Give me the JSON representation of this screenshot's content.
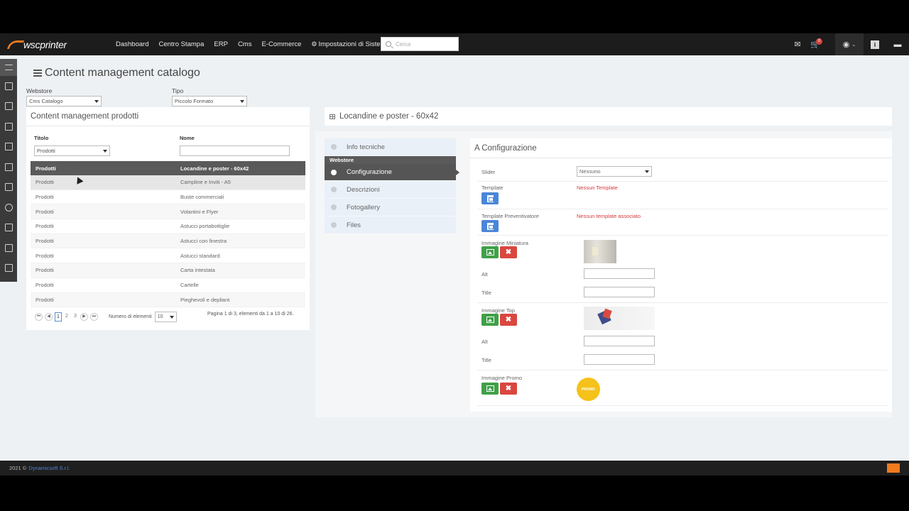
{
  "topbar": {
    "logo_text": "wscprinter",
    "menu": [
      "Dashboard",
      "Centro Stampa",
      "ERP",
      "Cms",
      "E-Commerce",
      "Impostazioni di Sistema"
    ],
    "search_placeholder": "Cerca",
    "cart_badge": "0"
  },
  "page": {
    "title": "Content management catalogo",
    "webstore_label": "Webstore",
    "webstore_value": "Cms Catalogo",
    "tipo_label": "Tipo",
    "tipo_value": "Piccolo Formato"
  },
  "left_panel": {
    "title": "Content management prodotti",
    "col_titolo": "Titolo",
    "col_nome": "Nome",
    "titolo_filter_value": "Prodotti",
    "table_header": [
      "Prodotti",
      "Locandine e poster - 60x42"
    ],
    "rows": [
      [
        "Prodotti",
        "Campline e Inviti - A5"
      ],
      [
        "Prodotti",
        "Buste commerciali"
      ],
      [
        "Prodotti",
        "Volantini e Flyer"
      ],
      [
        "Prodotti",
        "Astucci portabottiglie"
      ],
      [
        "Prodotti",
        "Astucci con finestra"
      ],
      [
        "Prodotti",
        "Astucci standard"
      ],
      [
        "Prodotti",
        "Carta intestata"
      ],
      [
        "Prodotti",
        "Cartelle"
      ],
      [
        "Prodotti",
        "Pieghevoli e depliant"
      ]
    ],
    "pager": {
      "pages": [
        "1",
        "2",
        "3"
      ],
      "active_page": "1",
      "per_page_label": "Numero di elementi",
      "per_page_value": "10",
      "info": "Pagina 1 di 3, elementi da 1 a 10 di 26."
    }
  },
  "right_panel": {
    "title": "Locandine e poster - 60x42",
    "tabs": {
      "info": "Info tecniche",
      "group": "Webstore",
      "config": "Configurazione",
      "descr": "Descrizioni",
      "gallery": "Fotogallery",
      "files": "Files"
    },
    "config": {
      "title": "A Configurazione",
      "slider_label": "Slider",
      "slider_value": "Nessuno",
      "template_label": "Template",
      "template_status": "Nessun Template",
      "template_prev_label": "Template Preventivatore",
      "template_prev_status": "Nessun template associato",
      "img_mini_label": "Immagine Miniatura",
      "alt_label": "Alt",
      "title_label": "Title",
      "img_top_label": "Immagine Top",
      "img_promo_label": "Immagine Promo",
      "promo_text": "PROMO"
    }
  },
  "footer": {
    "year": "2021 ©",
    "company": "Dynamicsoft S.r.l."
  },
  "colors": {
    "accent": "#f07a1e",
    "primary_blue": "#4a86d8",
    "success_green": "#3fa047",
    "danger_red": "#d9473f"
  }
}
